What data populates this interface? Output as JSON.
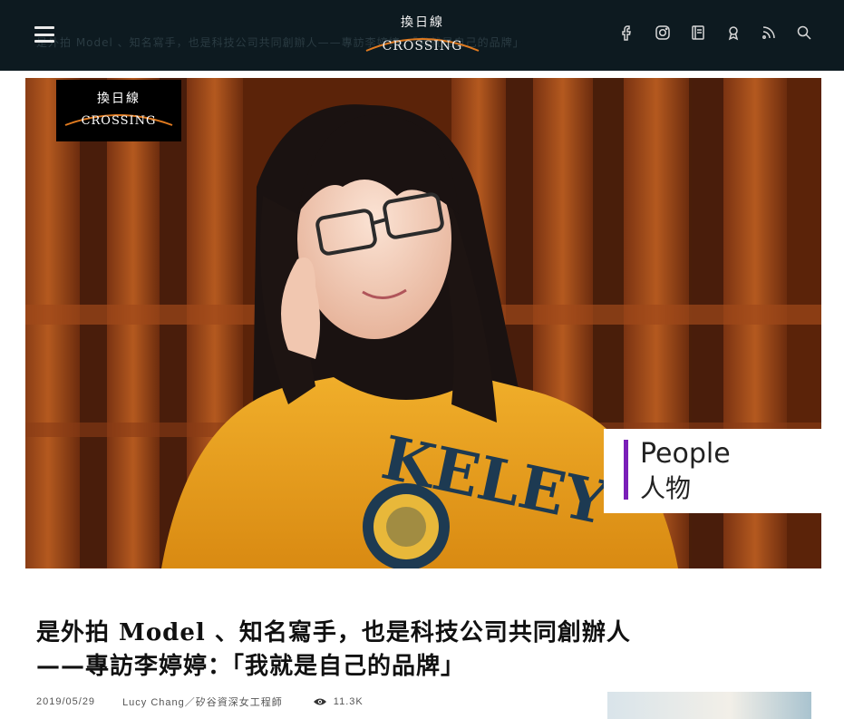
{
  "header": {
    "logo": {
      "zh": "換日線",
      "en": "CROSSING"
    },
    "ghost_text": "是外拍 Model 、知名寫手，也是科技公司共同創辦人——專訪李婷婷：「我就是自己的品牌」",
    "icons": [
      "menu-icon",
      "facebook-icon",
      "instagram-icon",
      "book-icon",
      "podcast-icon",
      "rss-icon",
      "search-icon"
    ]
  },
  "hero": {
    "logo": {
      "zh": "換日線",
      "en": "CROSSING"
    },
    "badge": {
      "en": "People",
      "zh": "人物",
      "accent": "#7a1fb8"
    },
    "sweater_text": "KELEY"
  },
  "article": {
    "title_line1": "是外拍 Model 、知名寫手，也是科技公司共同創辦人",
    "title_line2": "——專訪李婷婷：「我就是自己的品牌」",
    "date": "2019/05/29",
    "author": "Lucy Chang／矽谷資深女工程師",
    "views": "11.3K"
  },
  "colors": {
    "header_bg": "#0d1a20",
    "logo_arc": "#e07a1f",
    "badge_bar": "#7a1fb8"
  }
}
